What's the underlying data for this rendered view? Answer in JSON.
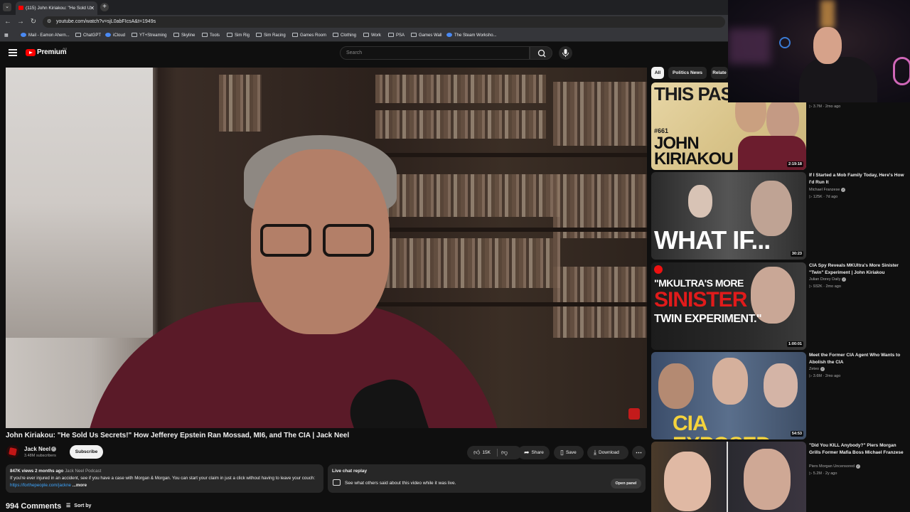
{
  "browser": {
    "tab_title": "(115) John Kiriakou: \"He Sold U",
    "url": "youtube.com/watch?v=sjL0abFIcsA&t=1949s",
    "bookmarks": [
      "Mail - Eamon Ahern...",
      "ChatGPT",
      "iCloud",
      "YT+Streaming",
      "Skyline",
      "Tools",
      "Sim Rig",
      "Sim Racing",
      "Games Room",
      "Clothing",
      "Work",
      "PSA",
      "Games Wall",
      "The Steam Worksho..."
    ]
  },
  "header": {
    "logo_text": "Premium",
    "region": "AU",
    "search_placeholder": "Search"
  },
  "video": {
    "title": "John Kiriakou: \"He Sold Us Secrets!\" How Jefferey Epstein Ran Mossad, MI6, and The CIA | Jack Neel",
    "channel": "Jack Neel",
    "subscribers": "3.48M subscribers",
    "subscribe_label": "Subscribe",
    "likes": "15K",
    "share_label": "Share",
    "save_label": "Save",
    "download_label": "Download"
  },
  "description": {
    "views": "847K views",
    "age": "2 months ago",
    "podcast": "Jack Neel Podcast",
    "text": "If you're ever injured in an accident, see if you have a case with Morgan & Morgan. You can start your claim in just a click without having to leave your couch:",
    "link": "https://forthepeople.com/jackne",
    "more": "...more"
  },
  "live_chat": {
    "title": "Live chat replay",
    "subtitle": "See what others said about this video while it was live.",
    "button": "Open panel"
  },
  "comments": {
    "count": "994 Comments",
    "sort_label": "Sort by"
  },
  "chips": [
    "All",
    "Politics News",
    "Relate"
  ],
  "recommendations": [
    {
      "thumb_line1": "THIS PAS",
      "thumb_line2": "#661",
      "thumb_line3": "JOHN",
      "thumb_line4": "KIRIAKOU",
      "duration": "2:19:18",
      "stats": "3.7M · 2mo ago"
    },
    {
      "thumb_text": "WHAT IF...",
      "duration": "30:23",
      "title": "If I Started a Mob Family Today, Here's How I'd Run It",
      "channel": "Michael Franzese",
      "stats": "125K · 7d ago"
    },
    {
      "thumb_line1": "\"MKULTRA'S MORE",
      "thumb_line2": "SINISTER",
      "thumb_line3": "TWIN EXPERIMENT.\"",
      "duration": "1:00:01",
      "title": "CIA Spy Reveals MKUltra's More Sinister \"Twin\" Experiment | John Kiriakou",
      "channel": "Julian Dorey Daily",
      "stats": "932K · 2mo ago"
    },
    {
      "thumb_text": "CIA EXPOSED",
      "duration": "54:53",
      "title": "Meet the Former CIA Agent Who Wants to Abolish the CIA",
      "channel": "Zeteo",
      "stats": "3.6M · 2mo ago"
    },
    {
      "title": "\"Did You KILL Anybody?\" Piers Morgan Grills Former Mafia Boss Michael Franzese",
      "channel": "Piers Morgan Uncensored",
      "stats": "5.2M · 2y ago"
    }
  ]
}
